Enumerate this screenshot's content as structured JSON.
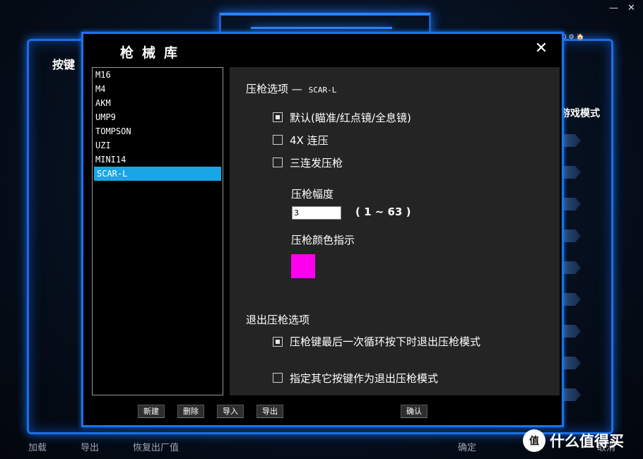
{
  "window_controls": {
    "minimize": "—",
    "close": "✕"
  },
  "background": {
    "title": "按键",
    "mode_label": "游戏模式",
    "top_icons": "0 ⚙ 🏠",
    "bottom_buttons": [
      {
        "label": "加载"
      },
      {
        "label": "导出"
      },
      {
        "label": "恢复出厂值"
      },
      {
        "label": "确定"
      },
      {
        "label": "取消"
      }
    ]
  },
  "watermark": {
    "logo": "值",
    "text": "什么值得买"
  },
  "dialog": {
    "title": "枪械库",
    "close": "✕",
    "weapons": [
      {
        "label": "M16"
      },
      {
        "label": "M4"
      },
      {
        "label": "AKM"
      },
      {
        "label": "UMP9"
      },
      {
        "label": "TOMPSON"
      },
      {
        "label": "UZI"
      },
      {
        "label": "MINI14"
      },
      {
        "label": "SCAR-L",
        "selected": true
      }
    ],
    "section_title": "压枪选项",
    "section_dash": "—",
    "section_weapon": "SCAR-L",
    "options": [
      {
        "label": "默认(瞄准/红点镜/全息镜)",
        "checked": true
      },
      {
        "label": "4X 连压",
        "checked": false
      },
      {
        "label": "三连发压枪",
        "checked": false
      }
    ],
    "amplitude_label": "压枪幅度",
    "amplitude_value": "3",
    "amplitude_range": "( 1 ~ 63 )",
    "color_label": "压枪颜色指示",
    "color_value": "#ff00ee",
    "exit_section_title": "退出压枪选项",
    "exit_options": [
      {
        "label": "压枪键最后一次循环按下时退出压枪模式",
        "checked": true
      },
      {
        "label": "指定其它按键作为退出压枪模式",
        "checked": false
      }
    ],
    "buttons": {
      "new": "新建",
      "delete": "删除",
      "import": "导入",
      "export": "导出",
      "confirm": "确认"
    }
  }
}
